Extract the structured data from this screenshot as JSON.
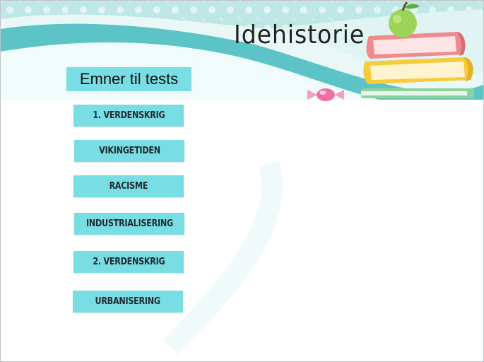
{
  "header": {
    "title": "Idehistorie"
  },
  "subtitle": "Emner til tests",
  "topics": [
    {
      "label": "1. VERDENSKRIG"
    },
    {
      "label": "VIKINGETIDEN"
    },
    {
      "label": "RACISME"
    },
    {
      "label": "INDUSTRIALISERING"
    },
    {
      "label": "2. VERDENSKRIG"
    },
    {
      "label": "URBANISERING"
    }
  ],
  "colors": {
    "accent": "#79dde4",
    "header_bg": "#dff4f3",
    "wave": "#5cc4c6",
    "apple": "#9ed35a",
    "book_pink": "#f08a8e",
    "book_yellow": "#f7cc3c"
  },
  "icons": {
    "books": "stacked-books-with-apple",
    "candy": "wrapped-candy"
  }
}
